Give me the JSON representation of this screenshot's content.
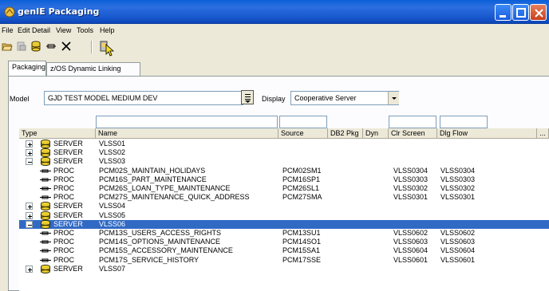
{
  "window": {
    "title": "genIE Packaging",
    "colors": {
      "titlebar": "#0a5fd8",
      "selection": "#316ac5"
    }
  },
  "menu": [
    "File",
    "Edit",
    "Detail",
    "View",
    "Tools",
    "Help"
  ],
  "toolbar": {
    "icons": [
      "open-folder-icon",
      "print-icon",
      "database-icon",
      "link-icon",
      "close-x-icon",
      "run-icon"
    ]
  },
  "tabs": [
    "Packaging",
    "z/OS Dynamic Linking"
  ],
  "model": {
    "label": "Model",
    "value": "GJD TEST MODEL MEDIUM DEV"
  },
  "display": {
    "label": "Display",
    "value": "Cooperative Server"
  },
  "grid": {
    "columns": [
      "Type",
      "Name",
      "Source",
      "DB2 Pkg",
      "Dyn",
      "Clr Screen",
      "Dlg Flow",
      "..."
    ],
    "rows": [
      {
        "tree": "plus",
        "type": "SERVER",
        "name": "VLSS01",
        "source": "",
        "clr": "",
        "dlg": ""
      },
      {
        "tree": "plus",
        "type": "SERVER",
        "name": "VLSS02",
        "source": "",
        "clr": "",
        "dlg": ""
      },
      {
        "tree": "minus",
        "type": "SERVER",
        "name": "VLSS03",
        "source": "",
        "clr": "",
        "dlg": ""
      },
      {
        "tree": "",
        "type": "PROC",
        "name": "PCM02S_MAINTAIN_HOLIDAYS",
        "source": "PCM02SM1",
        "clr": "VLSS0304",
        "dlg": "VLSS0304"
      },
      {
        "tree": "",
        "type": "PROC",
        "name": "PCM16S_PART_MAINTENANCE",
        "source": "PCM16SP1",
        "clr": "VLSS0303",
        "dlg": "VLSS0303"
      },
      {
        "tree": "",
        "type": "PROC",
        "name": "PCM26S_LOAN_TYPE_MAINTENANCE",
        "source": "PCM26SL1",
        "clr": "VLSS0302",
        "dlg": "VLSS0302"
      },
      {
        "tree": "",
        "type": "PROC",
        "name": "PCM27S_MAINTENANCE_QUICK_ADDRESS",
        "source": "PCM27SMA",
        "clr": "VLSS0301",
        "dlg": "VLSS0301"
      },
      {
        "tree": "plus",
        "type": "SERVER",
        "name": "VLSS04",
        "source": "",
        "clr": "",
        "dlg": ""
      },
      {
        "tree": "plus",
        "type": "SERVER",
        "name": "VLSS05",
        "source": "",
        "clr": "",
        "dlg": ""
      },
      {
        "tree": "minus",
        "type": "SERVER",
        "name": "VLSS06",
        "source": "",
        "clr": "",
        "dlg": "",
        "selected": true
      },
      {
        "tree": "",
        "type": "PROC",
        "name": "PCM13S_USERS_ACCESS_RIGHTS",
        "source": "PCM13SU1",
        "clr": "VLSS0602",
        "dlg": "VLSS0602"
      },
      {
        "tree": "",
        "type": "PROC",
        "name": "PCM14S_OPTIONS_MAINTENANCE",
        "source": "PCM14SO1",
        "clr": "VLSS0603",
        "dlg": "VLSS0603"
      },
      {
        "tree": "",
        "type": "PROC",
        "name": "PCM15S_ACCESSORY_MAINTENANCE",
        "source": "PCM15SA1",
        "clr": "VLSS0604",
        "dlg": "VLSS0604"
      },
      {
        "tree": "",
        "type": "PROC",
        "name": "PCM17S_SERVICE_HISTORY",
        "source": "PCM17SSE",
        "clr": "VLSS0601",
        "dlg": "VLSS0601"
      },
      {
        "tree": "plus",
        "type": "SERVER",
        "name": "VLSS07",
        "source": "",
        "clr": "",
        "dlg": ""
      }
    ]
  }
}
